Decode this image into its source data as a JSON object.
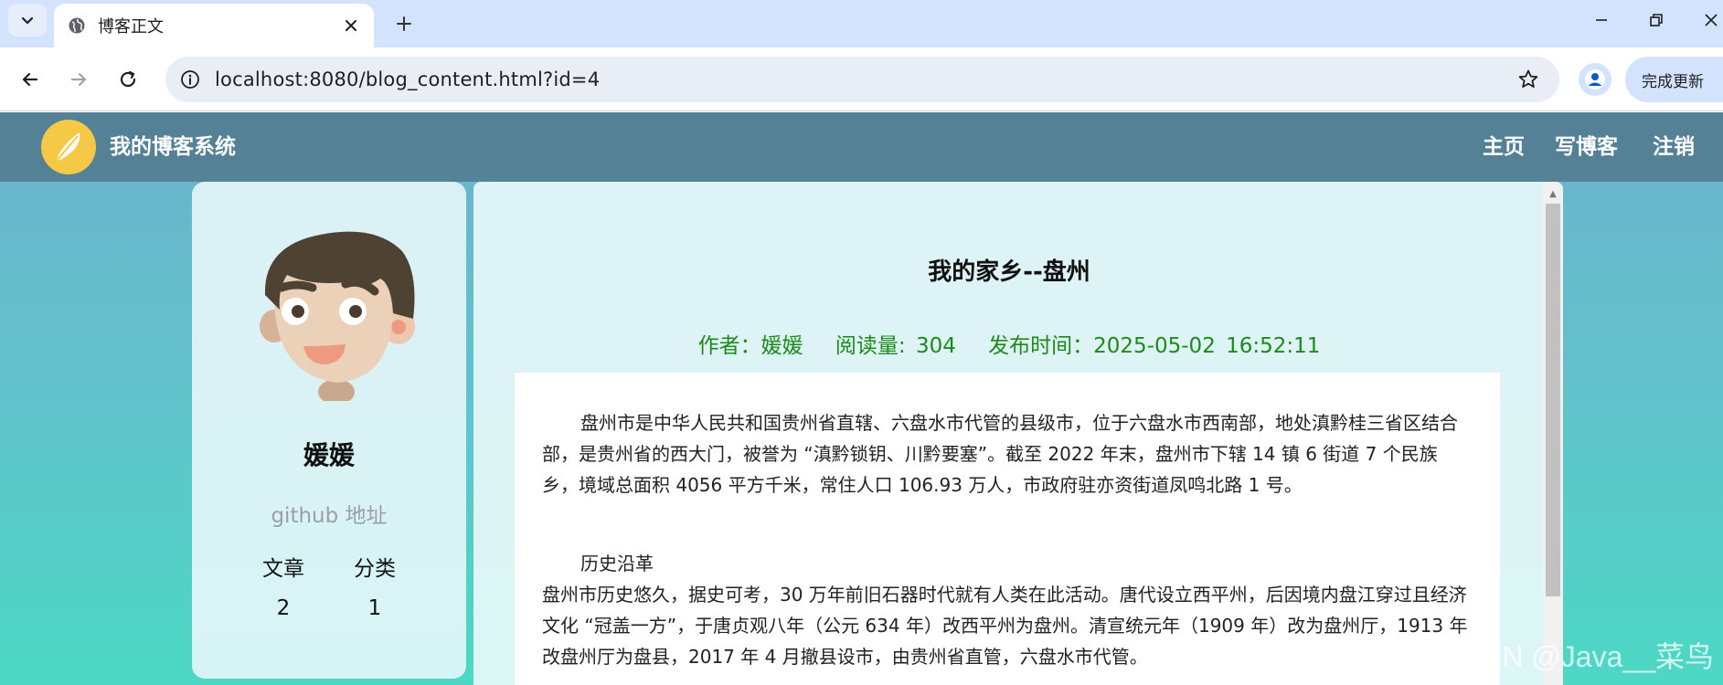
{
  "browser": {
    "tab_title": "博客正文",
    "url": "localhost:8080/blog_content.html?id=4",
    "update_label": "完成更新"
  },
  "site": {
    "title": "我的博客系统",
    "nav": {
      "home": "主页",
      "write": "写博客",
      "logout": "注销"
    }
  },
  "profile": {
    "username": "媛媛",
    "github_label": "github 地址",
    "articles_label": "文章",
    "categories_label": "分类",
    "articles_count": "2",
    "categories_count": "1"
  },
  "blog": {
    "title": "我的家乡--盘州",
    "author_label": "作者：",
    "author": "媛媛",
    "views_label": "阅读量:",
    "views": "304",
    "published_label": "发布时间：",
    "published": "2025-05-02 16:52:11",
    "paragraph1": "盘州市是中华人民共和国贵州省直辖、六盘水市代管的县级市，位于六盘水市西南部，地处滇黔桂三省区结合部，是贵州省的西大门，被誉为 “滇黔锁钥、川黔要塞”。截至 2022 年末，盘州市下辖 14 镇 6 街道 7 个民族乡，境域总面积 4056 平方千米，常住人口 106.93 万人，市政府驻亦资街道凤鸣北路 1 号。",
    "section_heading": "历史沿革",
    "paragraph2": "盘州市历史悠久，据史可考，30 万年前旧石器时代就有人类在此活动。唐代设立西平州，后因境内盘江穿过且经济文化 “冠盖一方”，于唐贞观八年（公元 634 年）改西平州为盘州。清宣统元年（1909 年）改为盘州厅，1913 年改盘州厅为盘县，2017 年 4 月撤县设市，由贵州省直管，六盘水市代管。"
  },
  "watermark": "CSDN @Java__菜鸟"
}
